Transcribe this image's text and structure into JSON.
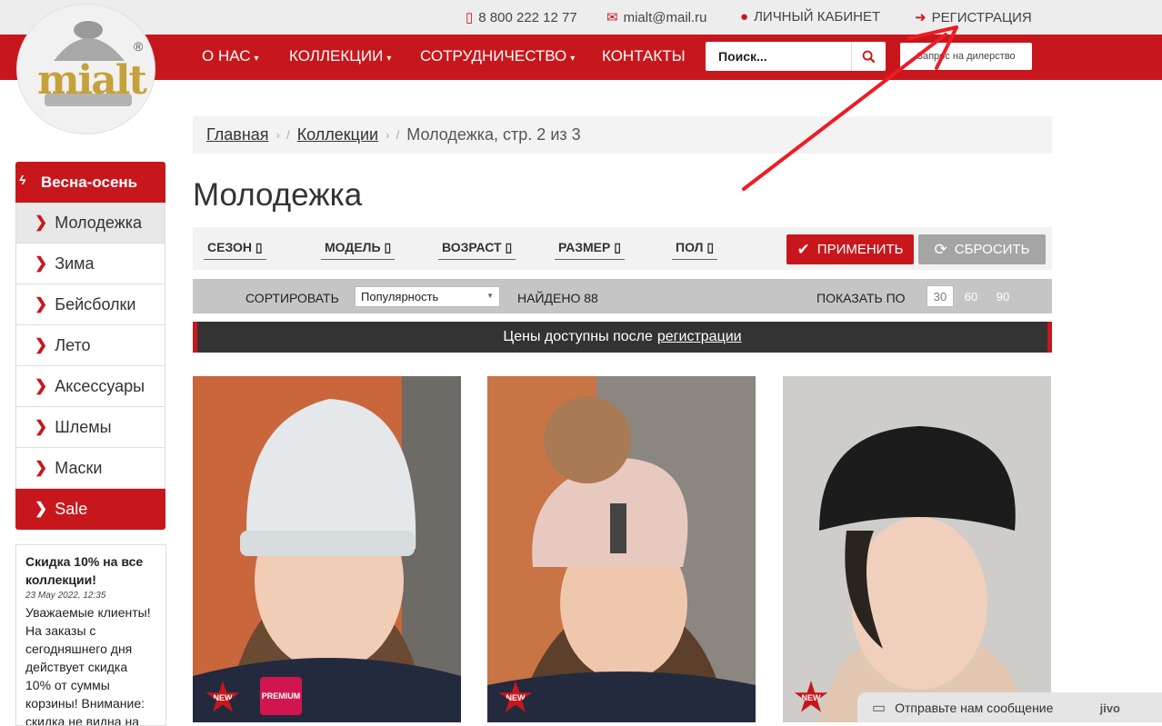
{
  "topbar": {
    "phone": "8 800 222 12 77",
    "email": "mialt@mail.ru",
    "account": "ЛИЧНЫЙ КАБИНЕТ",
    "register": "РЕГИСТРАЦИЯ"
  },
  "logo": {
    "text": "mialt",
    "reg": "®"
  },
  "nav": {
    "items": [
      {
        "label": "О НАС",
        "caret": "▾"
      },
      {
        "label": "КОЛЛЕКЦИИ",
        "caret": "▾"
      },
      {
        "label": "СОТРУДНИЧЕСТВО",
        "caret": "▾"
      },
      {
        "label": "КОНТАКТЫ",
        "caret": ""
      }
    ],
    "search_placeholder": "Поиск...",
    "dealer_button": "Запрос на дилерство"
  },
  "sidebar": {
    "header": "Весна-осень",
    "items": [
      {
        "label": "Молодежка"
      },
      {
        "label": "Зима"
      },
      {
        "label": "Бейсболки"
      },
      {
        "label": "Лето"
      },
      {
        "label": "Аксессуары"
      },
      {
        "label": "Шлемы"
      },
      {
        "label": "Маски"
      },
      {
        "label": "Sale"
      }
    ]
  },
  "news": {
    "title": "Скидка 10% на все коллекции!",
    "date": "23 May 2022, 12:35",
    "body": "Уважаемые клиенты! На заказы с сегодняшнего дня действует скидка 10% от суммы корзины! Внимание: скидка не видна на сайте и"
  },
  "breadcrumb": {
    "home": "Главная",
    "collections": "Коллекции",
    "current": "Молодежка, стр. 2 из 3"
  },
  "page_title": "Молодежка",
  "filters": {
    "items": [
      "СЕЗОН",
      "МОДЕЛЬ",
      "ВОЗРАСТ",
      "РАЗМЕР",
      "ПОЛ"
    ],
    "apply": "ПРИМЕНИТЬ",
    "reset": "СБРОСИТЬ"
  },
  "sort": {
    "label": "СОРТИРОВАТЬ",
    "selected": "Популярность",
    "found": "НАЙДЕНО 88",
    "show_label": "ПОКАЗАТЬ ПО",
    "per_page": [
      "30",
      "60",
      "90"
    ]
  },
  "notice": {
    "text": "Цены доступны после",
    "link": "регистрации"
  },
  "products": [
    {
      "badges": [
        "NEW",
        "PREMIUM"
      ]
    },
    {
      "badges": [
        "NEW"
      ]
    },
    {
      "badges": [
        "NEW"
      ]
    }
  ],
  "chat": {
    "text": "Отправьте нам сообщение",
    "brand": "jivo"
  },
  "colors": {
    "accent": "#c8171c",
    "dark_bar": "#333333",
    "gray_bar": "#c5c5c5"
  }
}
